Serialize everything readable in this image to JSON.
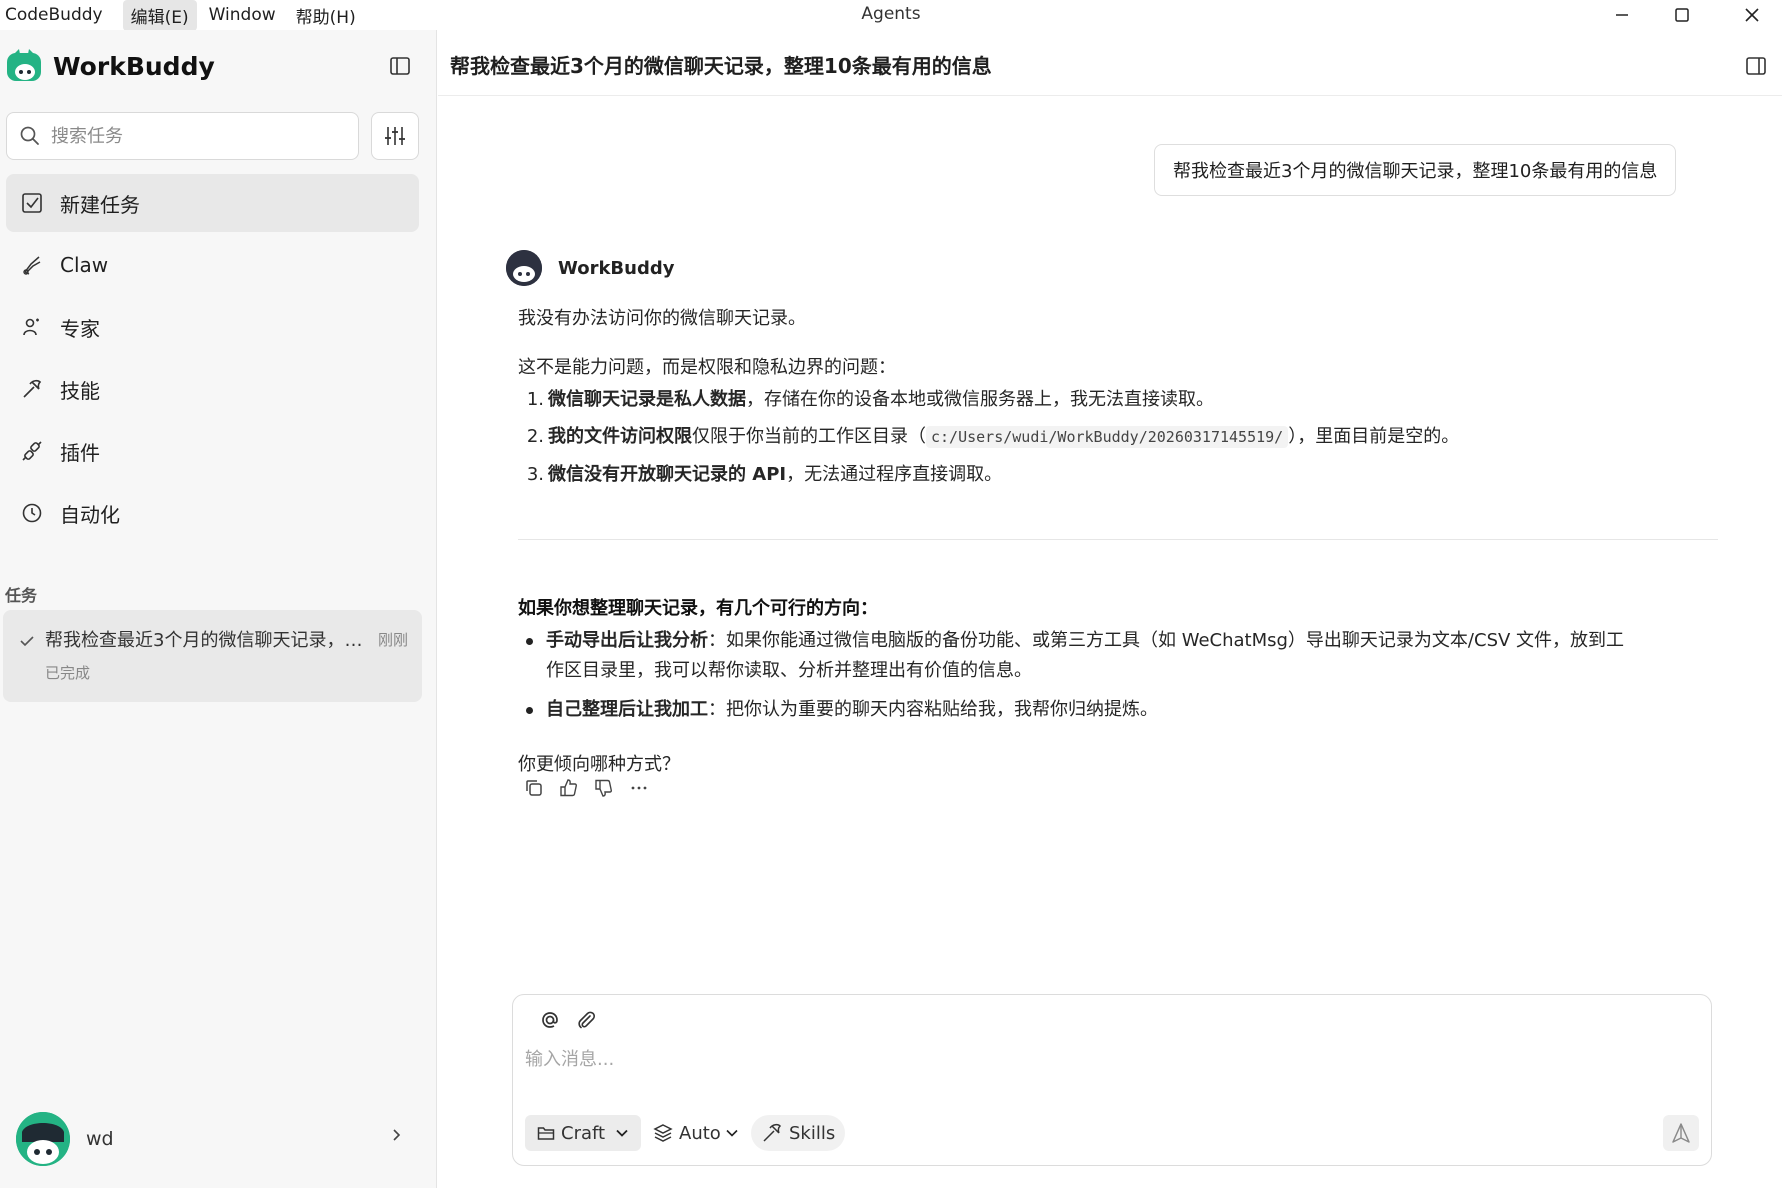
{
  "menubar": {
    "items": [
      {
        "label": "CodeBuddy"
      },
      {
        "label": "编辑(E)"
      },
      {
        "label": "Window"
      },
      {
        "label": "帮助(H)"
      }
    ],
    "window_title": "Agents"
  },
  "sidebar": {
    "brand": "WorkBuddy",
    "search_placeholder": "搜索任务",
    "nav": [
      {
        "label": "新建任务",
        "icon": "edit-square-icon"
      },
      {
        "label": "Claw",
        "icon": "claw-icon"
      },
      {
        "label": "专家",
        "icon": "expert-icon"
      },
      {
        "label": "技能",
        "icon": "skills-icon"
      },
      {
        "label": "插件",
        "icon": "plugin-icon"
      },
      {
        "label": "自动化",
        "icon": "clock-icon"
      }
    ],
    "section_label": "任务",
    "task": {
      "title": "帮我检查最近3个月的微信聊天记录，整理10条最有用的信息",
      "time": "刚刚",
      "status": "已完成"
    },
    "user": {
      "name": "wd"
    }
  },
  "main": {
    "title": "帮我检查最近3个月的微信聊天记录，整理10条最有用的信息",
    "user_message": "帮我检查最近3个月的微信聊天记录，整理10条最有用的信息",
    "bot": {
      "name": "WorkBuddy",
      "p1": "我没有办法访问你的微信聊天记录。",
      "p2": "这不是能力问题，而是权限和隐私边界的问题：",
      "ol": [
        {
          "num": "1.",
          "bold": "微信聊天记录是私人数据",
          "text": "，存储在你的设备本地或微信服务器上，我无法直接读取。"
        },
        {
          "num": "2.",
          "bold": "我的文件访问权限",
          "text_a": "仅限于你当前的工作区目录（",
          "code": "c:/Users/wudi/WorkBuddy/20260317145519/",
          "text_b": "），里面目前是空的。"
        },
        {
          "num": "3.",
          "bold": "微信没有开放聊天记录的 API",
          "text": "，无法通过程序直接调取。"
        }
      ],
      "heading": "如果你想整理聊天记录，有几个可行的方向：",
      "ul": [
        {
          "bold": "手动导出后让我分析",
          "line1": "：如果你能通过微信电脑版的备份功能、或第三方工具（如 WeChatMsg）导出聊天记录为文本/CSV 文件，放到工",
          "line2": "作区目录里，我可以帮你读取、分析并整理出有价值的信息。"
        },
        {
          "bold": "自己整理后让我加工",
          "text": "：把你认为重要的聊天内容粘贴给我，我帮你归纳提炼。"
        }
      ],
      "question": "你更倾向哪种方式？"
    }
  },
  "composer": {
    "placeholder": "输入消息...",
    "craft_label": "Craft",
    "auto_label": "Auto",
    "skills_label": "Skills"
  }
}
